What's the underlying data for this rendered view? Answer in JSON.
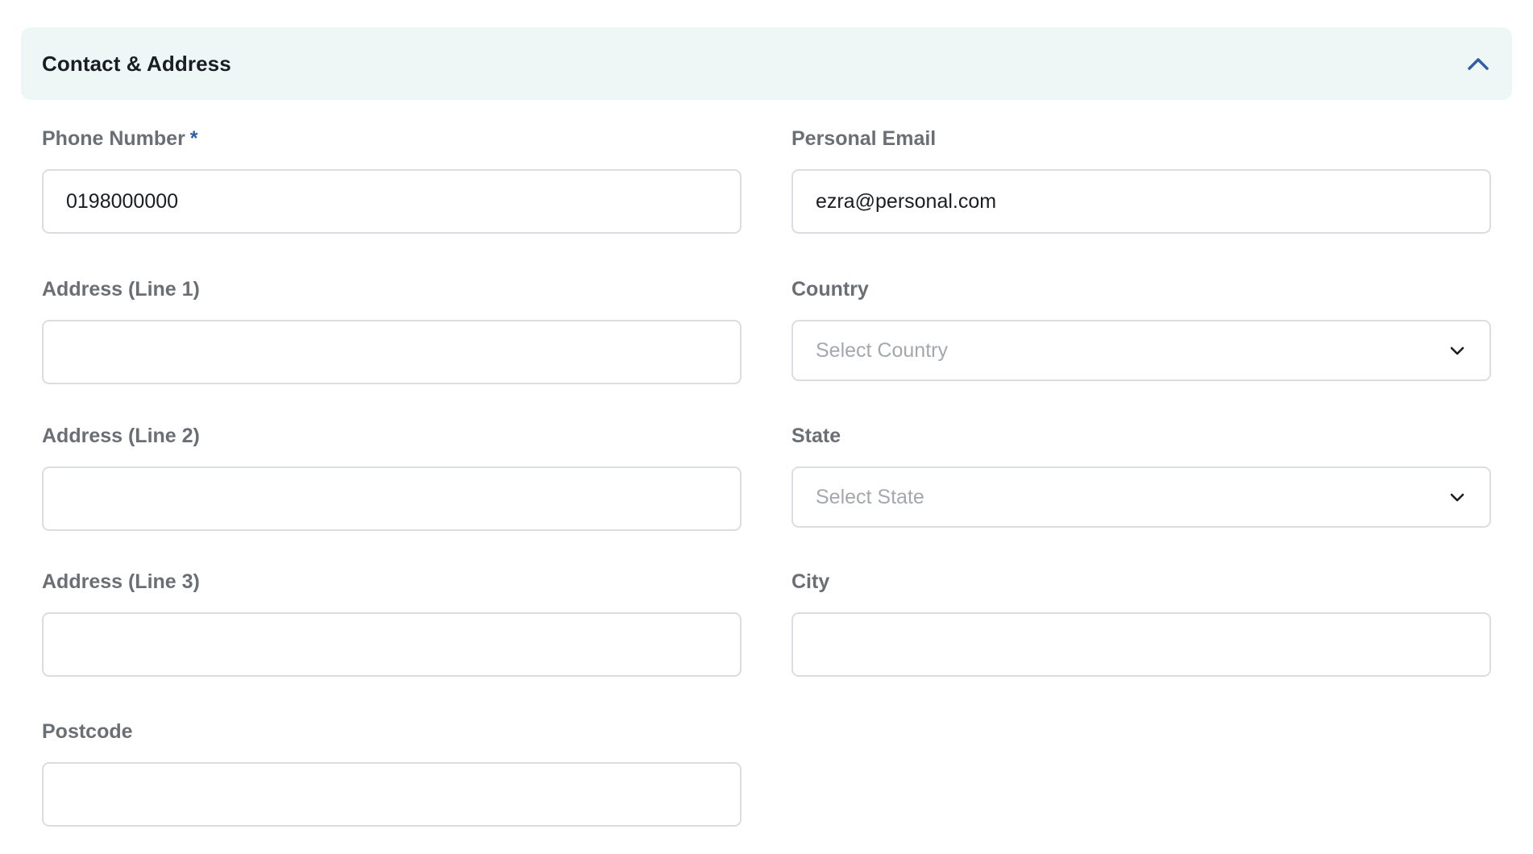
{
  "section": {
    "title": "Contact & Address",
    "expanded": true
  },
  "fields": {
    "phone": {
      "label": "Phone Number",
      "required_mark": "*",
      "value": "0198000000"
    },
    "personal_email": {
      "label": "Personal Email",
      "value": "ezra@personal.com"
    },
    "address_line1": {
      "label": "Address (Line 1)",
      "value": ""
    },
    "country": {
      "label": "Country",
      "placeholder": "Select Country"
    },
    "address_line2": {
      "label": "Address (Line 2)",
      "value": ""
    },
    "state": {
      "label": "State",
      "placeholder": "Select State"
    },
    "address_line3": {
      "label": "Address (Line 3)",
      "value": ""
    },
    "city": {
      "label": "City",
      "value": ""
    },
    "postcode": {
      "label": "Postcode",
      "value": ""
    }
  },
  "icons": {
    "collapse": "chevron-up-icon",
    "dropdown": "chevron-down-icon"
  },
  "colors": {
    "header_bg": "#eef7f5",
    "accent": "#2f5da8",
    "label": "#6a6f76",
    "border": "#dadde1",
    "placeholder": "#a4a8ad"
  }
}
